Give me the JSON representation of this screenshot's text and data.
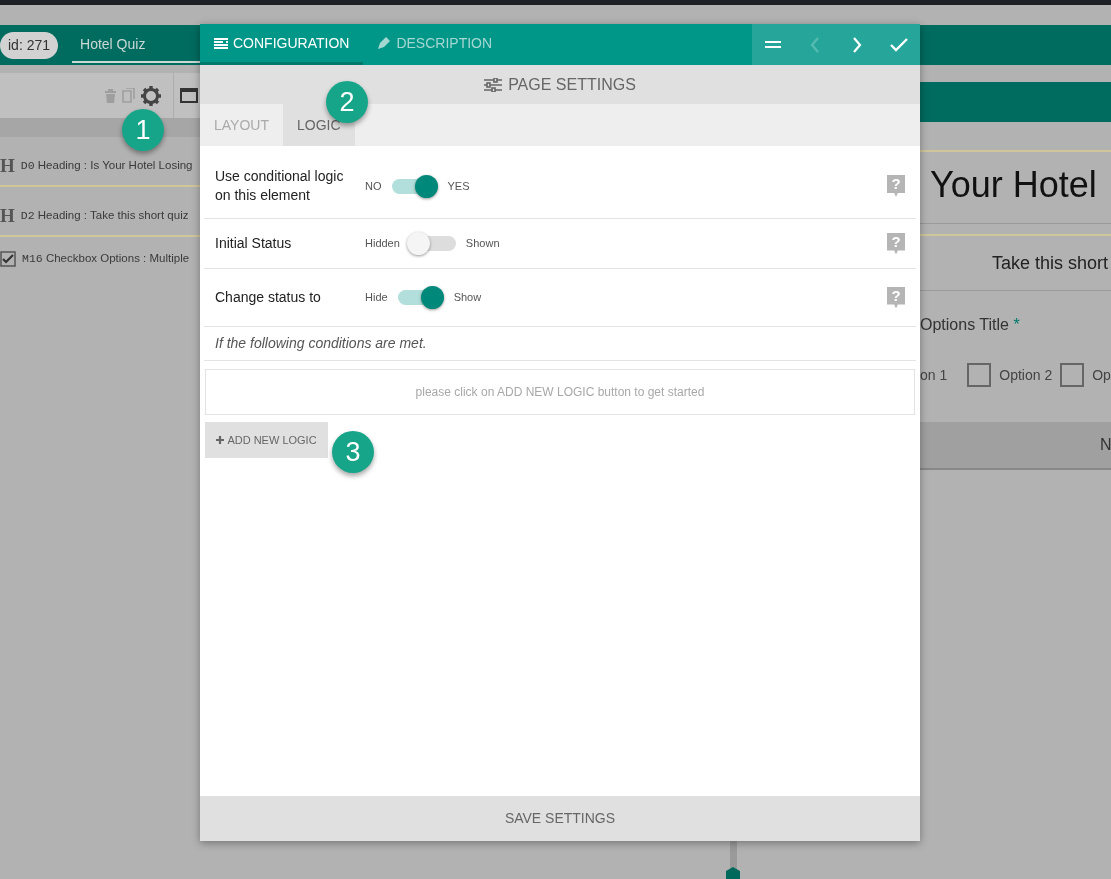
{
  "app_header": {
    "id_badge": "id: 271",
    "title": "Hotel Quiz"
  },
  "element_list": [
    {
      "kind": "heading",
      "glyph": "H",
      "code": "D0",
      "text": "Heading : Is Your Hotel Losing"
    },
    {
      "kind": "heading",
      "glyph": "H",
      "code": "D2",
      "text": "Heading : Take this short quiz"
    },
    {
      "kind": "checkbox",
      "code": "M16",
      "text": "Checkbox Options : Multiple"
    }
  ],
  "preview": {
    "heading": "Your Hotel",
    "subheading": "Take this short",
    "question": "Options Title",
    "required_mark": "*",
    "options": [
      {
        "label": "on 1"
      },
      {
        "label": "Option 2",
        "checked": false
      },
      {
        "label": "Op",
        "checked": false
      }
    ],
    "button": "N"
  },
  "modal": {
    "tabs": [
      {
        "kind": "config",
        "label": "CONFIGURATION",
        "selected": true
      },
      {
        "kind": "description",
        "label": "DESCRIPTION",
        "selected": false
      }
    ],
    "nav_buttons": [
      {
        "kind": "menu",
        "disabled": false
      },
      {
        "kind": "prev",
        "disabled": true
      },
      {
        "kind": "next",
        "disabled": false
      },
      {
        "kind": "done",
        "disabled": false
      }
    ],
    "section_title": "PAGE SETTINGS",
    "subtabs": [
      {
        "label": "LAYOUT",
        "selected": false
      },
      {
        "label": "LOGIC",
        "selected": true
      }
    ],
    "settings": [
      {
        "label": "Use conditional logic on this element",
        "off_label": "NO",
        "on_label": "YES",
        "on": true,
        "help": "?"
      },
      {
        "label": "Initial Status",
        "off_label": "Hidden",
        "on_label": "Shown",
        "on": false,
        "help": "?"
      },
      {
        "label": "Change status to",
        "off_label": "Hide",
        "on_label": "Show",
        "on": true,
        "help": "?"
      }
    ],
    "conditions_note": "If the following conditions are met.",
    "empty_message": "please click on ADD NEW LOGIC button to get started",
    "add_button": "ADD NEW LOGIC",
    "save_button": "SAVE SETTINGS"
  },
  "callouts": [
    "1",
    "2",
    "3"
  ]
}
